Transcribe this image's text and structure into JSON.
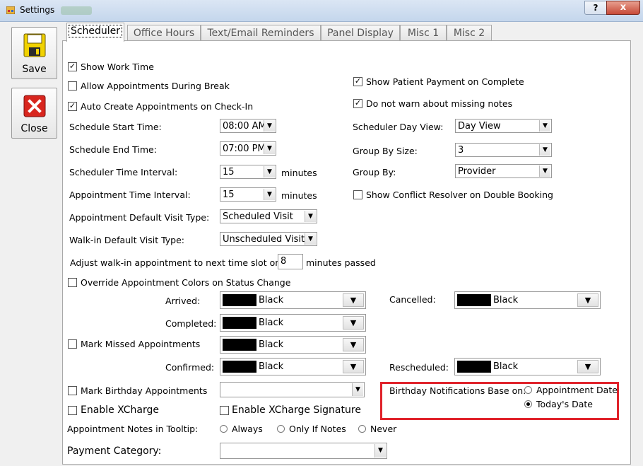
{
  "window": {
    "title": "Settings"
  },
  "titlebar": {
    "help": "?",
    "close": "x"
  },
  "sidebar": {
    "save_label": "Save",
    "close_label": "Close"
  },
  "tabs": [
    "Scheduler",
    "Office Hours",
    "Text/Email Reminders",
    "Panel Display",
    "Misc 1",
    "Misc 2"
  ],
  "left": {
    "show_work_time": "Show Work Time",
    "allow_break": "Allow Appointments During Break",
    "auto_create": "Auto Create Appointments on Check-In",
    "start_time_label": "Schedule Start Time:",
    "start_time_value": "08:00 AM",
    "end_time_label": "Schedule End Time:",
    "end_time_value": "07:00 PM",
    "sched_interval_label": "Scheduler Time Interval:",
    "sched_interval_value": "15",
    "appt_interval_label": "Appointment Time Interval:",
    "appt_interval_value": "15",
    "minutes": "minutes",
    "default_visit_label": "Appointment Default Visit Type:",
    "default_visit_value": "Scheduled Visit",
    "walkin_visit_label": "Walk-in Default Visit Type:",
    "walkin_visit_value": "Unscheduled Visit",
    "adjust_label": "Adjust walk-in appointment to next time slot on",
    "adjust_value": "8",
    "minutes_passed": "minutes passed"
  },
  "right": {
    "show_patient_payment": "Show Patient Payment on Complete",
    "no_warn_notes": "Do not warn about missing notes",
    "day_view_label": "Scheduler Day View:",
    "day_view_value": "Day View",
    "group_size_label": "Group By Size:",
    "group_size_value": "3",
    "group_by_label": "Group By:",
    "group_by_value": "Provider",
    "conflict_resolver": "Show Conflict Resolver on Double Booking"
  },
  "colors": {
    "override": "Override Appointment Colors on Status Change",
    "arrived_label": "Arrived:",
    "arrived_value": "Black",
    "completed_label": "Completed:",
    "completed_value": "Black",
    "missed_label": "Mark Missed Appointments",
    "missed_value": "Black",
    "confirmed_label": "Confirmed:",
    "confirmed_value": "Black",
    "cancelled_label": "Cancelled:",
    "cancelled_value": "Black",
    "rescheduled_label": "Rescheduled:",
    "rescheduled_value": "Black",
    "swatch": "#000000"
  },
  "birthday": {
    "mark_label": "Mark Birthday Appointments",
    "notif_label": "Birthday Notifications Base on:",
    "opt_appt": "Appointment Date",
    "opt_today": "Today's Date"
  },
  "xcharge": {
    "enable": "Enable XCharge",
    "signature": "Enable XCharge Signature"
  },
  "tooltip": {
    "label": "Appointment Notes in Tooltip:",
    "always": "Always",
    "only_if": "Only If Notes",
    "never": "Never"
  },
  "payment": {
    "label": "Payment Category:"
  },
  "accent": {
    "highlight": "#e0232b"
  }
}
